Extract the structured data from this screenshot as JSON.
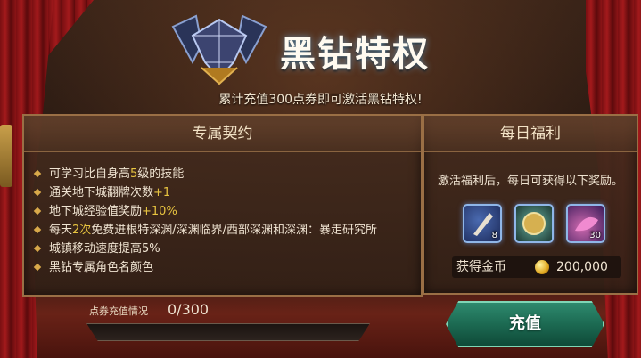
{
  "header": {
    "title": "黑钻特权",
    "subtitle": "累计充值300点券即可激活黑钻特权!"
  },
  "contract": {
    "heading": "专属契约",
    "benefits": [
      {
        "before": "可学习比自身高",
        "highlight": "5",
        "after": "级的技能"
      },
      {
        "before": "通关地下城翻牌次数",
        "highlight": "+1",
        "after": ""
      },
      {
        "before": "地下城经验值奖励",
        "highlight": "+10%",
        "after": ""
      },
      {
        "before": "每天",
        "highlight": "2次",
        "after": "免费进根特深渊/深渊临界/西部深渊和深渊：暴走研究所"
      },
      {
        "before": "城镇移动速度提高5%",
        "highlight": "",
        "after": ""
      },
      {
        "before": "黑钻专属角色名颜色",
        "highlight": "",
        "after": ""
      }
    ]
  },
  "daily": {
    "heading": "每日福利",
    "description": "激活福利后，每日可获得以下奖励。",
    "items": [
      {
        "icon": "skill-scroll-icon",
        "qty": "8"
      },
      {
        "icon": "gold-medal-icon",
        "qty": ""
      },
      {
        "icon": "magic-potion-icon",
        "qty": "30"
      }
    ],
    "gold_label": "获得金币",
    "gold_value": "200,000"
  },
  "progress": {
    "label": "点券充值情况",
    "value_text": "0/300",
    "fraction": 0
  },
  "actions": {
    "recharge_label": "充值"
  },
  "colors": {
    "highlight": "#e8c440",
    "panel_border": "#9a6f45",
    "button_green": "#1c6a52",
    "curtain_red": "#a31a1c"
  }
}
